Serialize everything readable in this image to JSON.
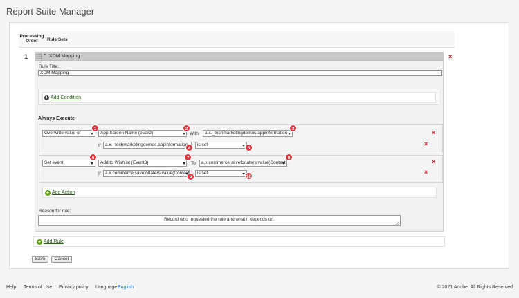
{
  "app": {
    "title": "Report Suite Manager"
  },
  "table": {
    "col_order_line1": "Processing",
    "col_order_line2": "Order",
    "col_rule_sets": "Rule Sets"
  },
  "rule": {
    "order": "1",
    "header_label": "XDM Mapping",
    "title_label": "Rule Title:",
    "title_value": "XDM Mapping",
    "add_condition": "Add Condition",
    "always_execute": "Always Execute",
    "actions": [
      {
        "verb": "Overwrite value of",
        "target": "App Screen Name (eVar2)",
        "connector": "With",
        "value": "a.x._techmarketingdemos.appinformation",
        "if_label": "If",
        "condition_field": "a.x._techmarketingdemos.appinformation",
        "condition_op": "is set",
        "badges": [
          "1",
          "2",
          "3",
          "4",
          "5"
        ]
      },
      {
        "verb": "Set event",
        "target": "Add to Wishlist (Event3)",
        "connector": "To",
        "value": "a.x.commerce.saveforlaters.value(Context",
        "if_label": "If",
        "condition_field": "a.x.commerce.saveforlaters.value(Context",
        "condition_op": "is set",
        "badges": [
          "6",
          "7",
          "8",
          "9",
          "10"
        ]
      }
    ],
    "add_action": "Add Action",
    "reason_label": "Reason for rule:",
    "reason_value": "Record who requested the rule and what it depends on."
  },
  "add_rule": "Add Rule",
  "buttons": {
    "save": "Save",
    "cancel": "Cancel"
  },
  "footer": {
    "help": "Help",
    "terms": "Terms of Use",
    "privacy": "Privacy policy",
    "language_label": "Language:",
    "language_value": "English",
    "copyright": "© 2021 Adobe. All Rights Reserved"
  },
  "colors": {
    "badge": "#e5303c",
    "delete": "#d0021b",
    "link_green": "#2c5e1a",
    "language_link": "#1473e6"
  },
  "icons": [
    "grip-icon",
    "collapse-caret-icon",
    "delete-x-icon",
    "add-circle-icon",
    "dropdown-caret-icon",
    "resize-handle-icon"
  ]
}
